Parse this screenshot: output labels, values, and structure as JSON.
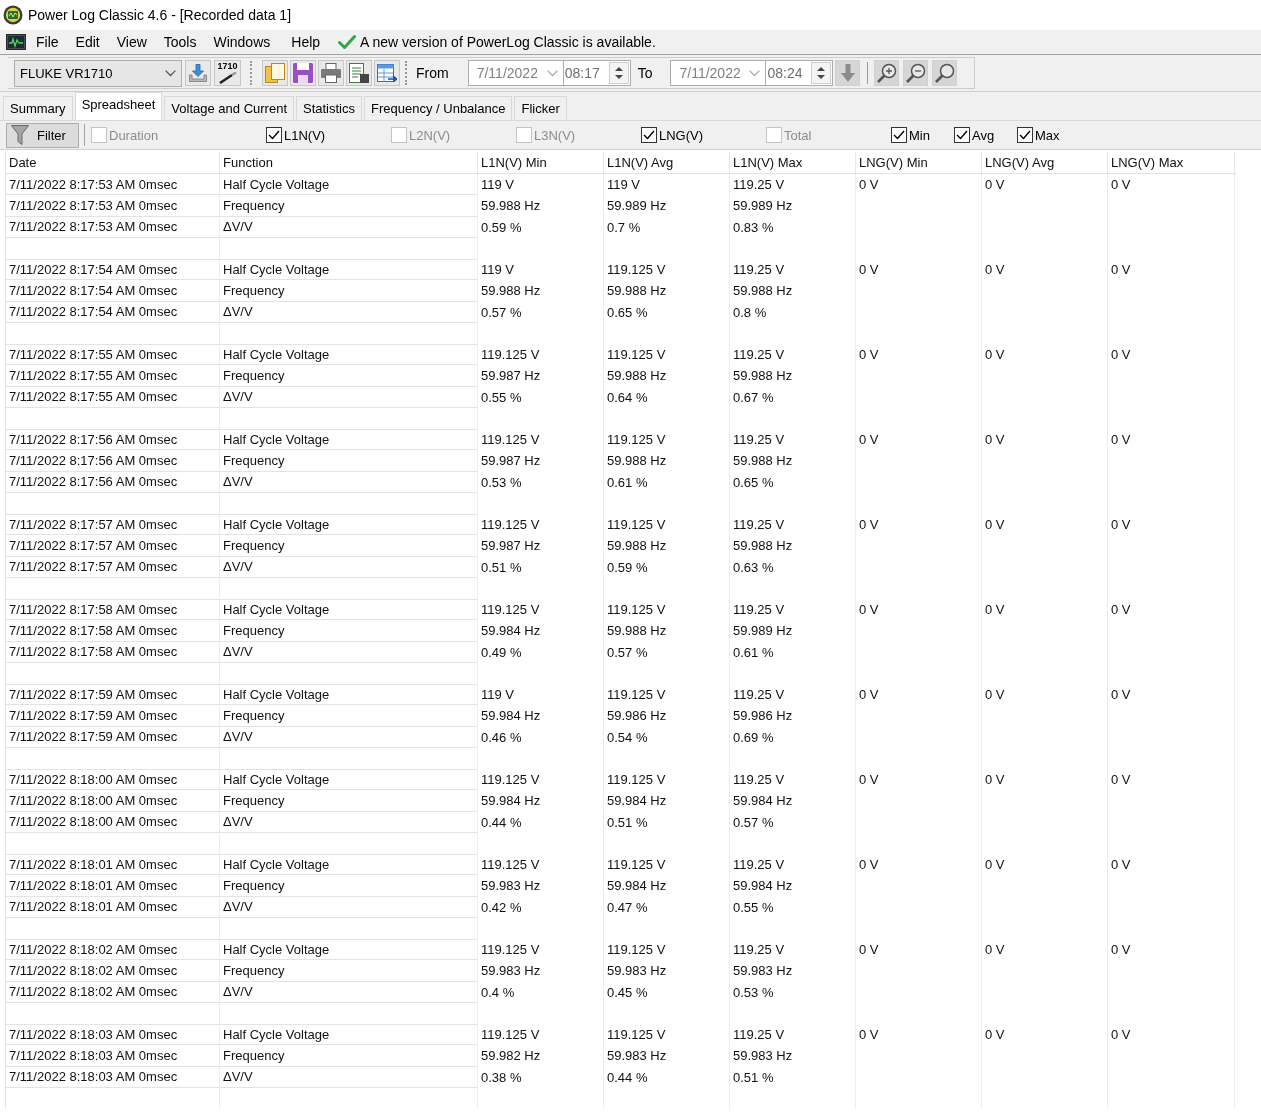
{
  "window": {
    "title": "Power Log Classic 4.6 - [Recorded data 1]"
  },
  "menu": {
    "items": [
      "File",
      "Edit",
      "View",
      "Tools",
      "Windows",
      "Help"
    ],
    "notice": "A new version of PowerLog Classic is available."
  },
  "toolbar": {
    "device": "FLUKE VR1710",
    "device_tool_text": "1710",
    "from_label": "From",
    "from_date": "7/11/2022",
    "from_time": "08:17",
    "to_label": "To",
    "to_date": "7/11/2022",
    "to_time": "08:24"
  },
  "tabs": [
    {
      "label": "Summary",
      "selected": false
    },
    {
      "label": "Spreadsheet",
      "selected": true
    },
    {
      "label": "Voltage and Current",
      "selected": false
    },
    {
      "label": "Statistics",
      "selected": false
    },
    {
      "label": "Frequency / Unbalance",
      "selected": false
    },
    {
      "label": "Flicker",
      "selected": false
    }
  ],
  "filter_bar": {
    "button": "Filter",
    "options": [
      {
        "label": "Duration",
        "checked": false,
        "disabled": true
      },
      {
        "label": "L1N(V)",
        "checked": true,
        "disabled": false
      },
      {
        "label": "L2N(V)",
        "checked": false,
        "disabled": true
      },
      {
        "label": "L3N(V)",
        "checked": false,
        "disabled": true
      },
      {
        "label": "LNG(V)",
        "checked": true,
        "disabled": false
      },
      {
        "label": "Total",
        "checked": false,
        "disabled": true
      }
    ],
    "statistics": [
      {
        "label": "Min",
        "checked": true,
        "disabled": false
      },
      {
        "label": "Avg",
        "checked": true,
        "disabled": false
      },
      {
        "label": "Max",
        "checked": true,
        "disabled": false
      }
    ]
  },
  "table": {
    "columns": [
      "Date",
      "Function",
      "L1N(V) Min",
      "L1N(V) Avg",
      "L1N(V) Max",
      "LNG(V) Min",
      "LNG(V) Avg",
      "LNG(V) Max"
    ],
    "groups": [
      {
        "rows": [
          {
            "date": "7/11/2022 8:17:53 AM 0msec",
            "function": "Half Cycle Voltage",
            "values": [
              "119 V",
              "119 V",
              "119.25 V",
              "0 V",
              "0 V",
              "0 V"
            ]
          },
          {
            "date": "7/11/2022 8:17:53 AM 0msec",
            "function": "Frequency",
            "values": [
              "59.988 Hz",
              "59.989 Hz",
              "59.989 Hz"
            ]
          },
          {
            "date": "7/11/2022 8:17:53 AM 0msec",
            "function": "ΔV/V",
            "values": [
              "0.59 %",
              "0.7 %",
              "0.83 %"
            ]
          }
        ]
      },
      {
        "rows": [
          {
            "date": "7/11/2022 8:17:54 AM 0msec",
            "function": "Half Cycle Voltage",
            "values": [
              "119 V",
              "119.125 V",
              "119.25 V",
              "0 V",
              "0 V",
              "0 V"
            ]
          },
          {
            "date": "7/11/2022 8:17:54 AM 0msec",
            "function": "Frequency",
            "values": [
              "59.988 Hz",
              "59.988 Hz",
              "59.988 Hz"
            ]
          },
          {
            "date": "7/11/2022 8:17:54 AM 0msec",
            "function": "ΔV/V",
            "values": [
              "0.57 %",
              "0.65 %",
              "0.8 %"
            ]
          }
        ]
      },
      {
        "rows": [
          {
            "date": "7/11/2022 8:17:55 AM 0msec",
            "function": "Half Cycle Voltage",
            "values": [
              "119.125 V",
              "119.125 V",
              "119.25 V",
              "0 V",
              "0 V",
              "0 V"
            ]
          },
          {
            "date": "7/11/2022 8:17:55 AM 0msec",
            "function": "Frequency",
            "values": [
              "59.987 Hz",
              "59.988 Hz",
              "59.988 Hz"
            ]
          },
          {
            "date": "7/11/2022 8:17:55 AM 0msec",
            "function": "ΔV/V",
            "values": [
              "0.55 %",
              "0.64 %",
              "0.67 %"
            ]
          }
        ]
      },
      {
        "rows": [
          {
            "date": "7/11/2022 8:17:56 AM 0msec",
            "function": "Half Cycle Voltage",
            "values": [
              "119.125 V",
              "119.125 V",
              "119.25 V",
              "0 V",
              "0 V",
              "0 V"
            ]
          },
          {
            "date": "7/11/2022 8:17:56 AM 0msec",
            "function": "Frequency",
            "values": [
              "59.987 Hz",
              "59.988 Hz",
              "59.988 Hz"
            ]
          },
          {
            "date": "7/11/2022 8:17:56 AM 0msec",
            "function": "ΔV/V",
            "values": [
              "0.53 %",
              "0.61 %",
              "0.65 %"
            ]
          }
        ]
      },
      {
        "rows": [
          {
            "date": "7/11/2022 8:17:57 AM 0msec",
            "function": "Half Cycle Voltage",
            "values": [
              "119.125 V",
              "119.125 V",
              "119.25 V",
              "0 V",
              "0 V",
              "0 V"
            ]
          },
          {
            "date": "7/11/2022 8:17:57 AM 0msec",
            "function": "Frequency",
            "values": [
              "59.987 Hz",
              "59.988 Hz",
              "59.988 Hz"
            ]
          },
          {
            "date": "7/11/2022 8:17:57 AM 0msec",
            "function": "ΔV/V",
            "values": [
              "0.51 %",
              "0.59 %",
              "0.63 %"
            ]
          }
        ]
      },
      {
        "rows": [
          {
            "date": "7/11/2022 8:17:58 AM 0msec",
            "function": "Half Cycle Voltage",
            "values": [
              "119.125 V",
              "119.125 V",
              "119.25 V",
              "0 V",
              "0 V",
              "0 V"
            ]
          },
          {
            "date": "7/11/2022 8:17:58 AM 0msec",
            "function": "Frequency",
            "values": [
              "59.984 Hz",
              "59.988 Hz",
              "59.989 Hz"
            ]
          },
          {
            "date": "7/11/2022 8:17:58 AM 0msec",
            "function": "ΔV/V",
            "values": [
              "0.49 %",
              "0.57 %",
              "0.61 %"
            ]
          }
        ]
      },
      {
        "rows": [
          {
            "date": "7/11/2022 8:17:59 AM 0msec",
            "function": "Half Cycle Voltage",
            "values": [
              "119 V",
              "119.125 V",
              "119.25 V",
              "0 V",
              "0 V",
              "0 V"
            ]
          },
          {
            "date": "7/11/2022 8:17:59 AM 0msec",
            "function": "Frequency",
            "values": [
              "59.984 Hz",
              "59.986 Hz",
              "59.986 Hz"
            ]
          },
          {
            "date": "7/11/2022 8:17:59 AM 0msec",
            "function": "ΔV/V",
            "values": [
              "0.46 %",
              "0.54 %",
              "0.69 %"
            ]
          }
        ]
      },
      {
        "rows": [
          {
            "date": "7/11/2022 8:18:00 AM 0msec",
            "function": "Half Cycle Voltage",
            "values": [
              "119.125 V",
              "119.125 V",
              "119.25 V",
              "0 V",
              "0 V",
              "0 V"
            ]
          },
          {
            "date": "7/11/2022 8:18:00 AM 0msec",
            "function": "Frequency",
            "values": [
              "59.984 Hz",
              "59.984 Hz",
              "59.984 Hz"
            ]
          },
          {
            "date": "7/11/2022 8:18:00 AM 0msec",
            "function": "ΔV/V",
            "values": [
              "0.44 %",
              "0.51 %",
              "0.57 %"
            ]
          }
        ]
      },
      {
        "rows": [
          {
            "date": "7/11/2022 8:18:01 AM 0msec",
            "function": "Half Cycle Voltage",
            "values": [
              "119.125 V",
              "119.125 V",
              "119.25 V",
              "0 V",
              "0 V",
              "0 V"
            ]
          },
          {
            "date": "7/11/2022 8:18:01 AM 0msec",
            "function": "Frequency",
            "values": [
              "59.983 Hz",
              "59.984 Hz",
              "59.984 Hz"
            ]
          },
          {
            "date": "7/11/2022 8:18:01 AM 0msec",
            "function": "ΔV/V",
            "values": [
              "0.42 %",
              "0.47 %",
              "0.55 %"
            ]
          }
        ]
      },
      {
        "rows": [
          {
            "date": "7/11/2022 8:18:02 AM 0msec",
            "function": "Half Cycle Voltage",
            "values": [
              "119.125 V",
              "119.125 V",
              "119.25 V",
              "0 V",
              "0 V",
              "0 V"
            ]
          },
          {
            "date": "7/11/2022 8:18:02 AM 0msec",
            "function": "Frequency",
            "values": [
              "59.983 Hz",
              "59.983 Hz",
              "59.983 Hz"
            ]
          },
          {
            "date": "7/11/2022 8:18:02 AM 0msec",
            "function": "ΔV/V",
            "values": [
              "0.4 %",
              "0.45 %",
              "0.53 %"
            ]
          }
        ]
      },
      {
        "rows": [
          {
            "date": "7/11/2022 8:18:03 AM 0msec",
            "function": "Half Cycle Voltage",
            "values": [
              "119.125 V",
              "119.125 V",
              "119.25 V",
              "0 V",
              "0 V",
              "0 V"
            ]
          },
          {
            "date": "7/11/2022 8:18:03 AM 0msec",
            "function": "Frequency",
            "values": [
              "59.982 Hz",
              "59.983 Hz",
              "59.983 Hz"
            ]
          },
          {
            "date": "7/11/2022 8:18:03 AM 0msec",
            "function": "ΔV/V",
            "values": [
              "0.38 %",
              "0.44 %",
              "0.51 %"
            ]
          }
        ]
      }
    ]
  }
}
